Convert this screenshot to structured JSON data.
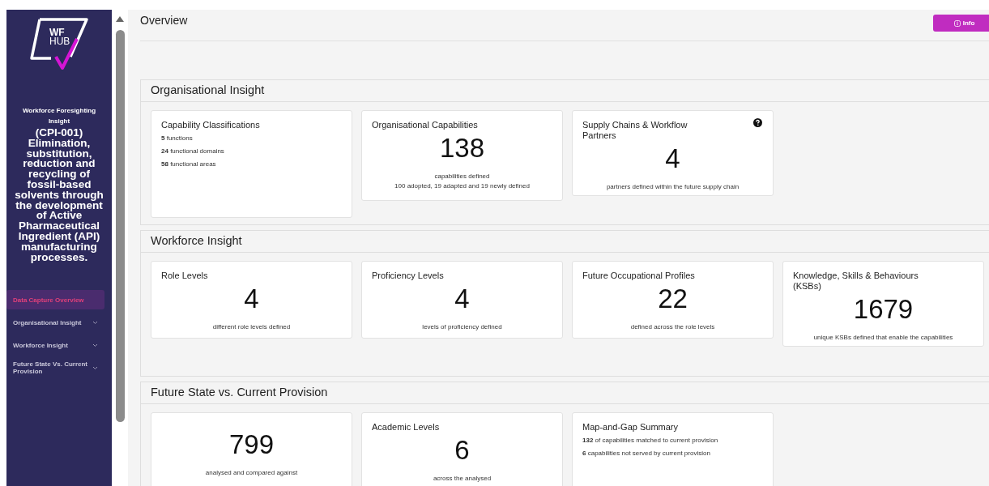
{
  "sidebar": {
    "logo": {
      "lines": [
        "WF",
        "HUB"
      ]
    },
    "subtitle": "Workforce Foresighting Insight",
    "title": "(CPI-001) Elimination, substitution, reduction and recycling of fossil-based solvents through the development of Active Pharmaceutical Ingredient (API) manufacturing processes.",
    "nav": [
      {
        "label": "Data Capture Overview",
        "selected": true,
        "expandable": false
      },
      {
        "label": "Organisational Insight",
        "selected": false,
        "expandable": true
      },
      {
        "label": "Workforce Insight",
        "selected": false,
        "expandable": true
      },
      {
        "label": "Future State Vs. Current Provision",
        "selected": false,
        "expandable": true
      }
    ]
  },
  "header": {
    "title": "Overview",
    "info_button": "Info"
  },
  "sections": [
    {
      "title": "Organisational Insight",
      "cards": [
        {
          "kind": "list",
          "title": "Capability Classifications",
          "lines": [
            "**5** functions",
            "**24** functional domains",
            "**58** functional areas"
          ]
        },
        {
          "kind": "stat",
          "title": "Organisational Capabilities",
          "value": "138",
          "captions": [
            "capabilities defined",
            "100 adopted, 19 adapted and 19 newly defined"
          ]
        },
        {
          "kind": "stat",
          "title": "Supply Chains & Workflow Partners",
          "help": true,
          "value": "4",
          "captions": [
            "partners defined within the future supply chain"
          ]
        }
      ]
    },
    {
      "title": "Workforce Insight",
      "cards": [
        {
          "kind": "stat",
          "title": "Role Levels",
          "value": "4",
          "captions": [
            "different role levels defined"
          ]
        },
        {
          "kind": "stat",
          "title": "Proficiency Levels",
          "value": "4",
          "captions": [
            "levels of proficiency defined"
          ]
        },
        {
          "kind": "stat",
          "title": "Future Occupational Profiles",
          "value": "22",
          "captions": [
            "defined across the role levels"
          ]
        },
        {
          "kind": "stat",
          "title": "Knowledge, Skills & Behaviours (KSBs)",
          "value": "1679",
          "captions": [
            "unique KSBs defined that enable the capabilities"
          ]
        }
      ]
    },
    {
      "title": "Future State vs. Current Provision",
      "cards": [
        {
          "kind": "stat",
          "value": "799",
          "captions": [
            "analysed and compared against"
          ]
        },
        {
          "kind": "stat",
          "title": "Academic Levels",
          "value": "6",
          "captions": [
            "across the analysed"
          ]
        },
        {
          "kind": "list",
          "title": "Map-and-Gap Summary",
          "lines": [
            "**132** of capabilities matched to current provision",
            "**6** capabilities not served by current provision"
          ]
        }
      ]
    }
  ]
}
